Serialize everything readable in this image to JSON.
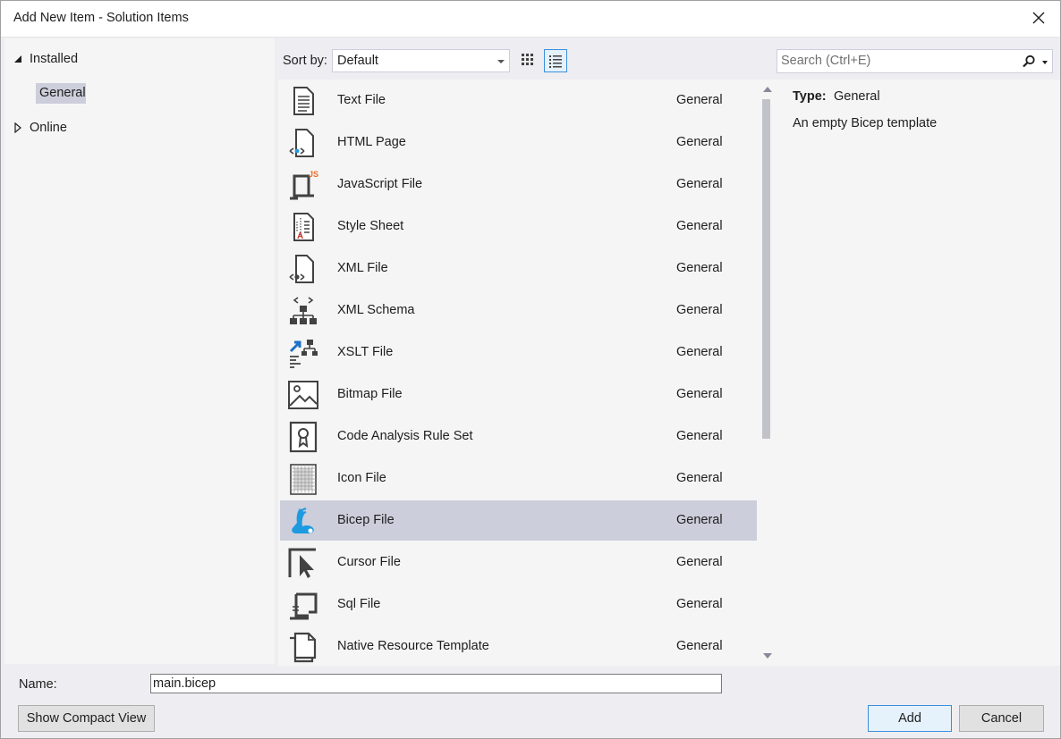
{
  "window": {
    "title": "Add New Item - Solution Items"
  },
  "tree": {
    "installed": "Installed",
    "general": "General",
    "online": "Online"
  },
  "toolbar": {
    "sort_label": "Sort by:",
    "sort_value": "Default"
  },
  "search": {
    "placeholder": "Search (Ctrl+E)"
  },
  "items": [
    {
      "name": "Text File",
      "category": "General",
      "icon": "text-file-icon"
    },
    {
      "name": "HTML Page",
      "category": "General",
      "icon": "html-page-icon"
    },
    {
      "name": "JavaScript File",
      "category": "General",
      "icon": "javascript-file-icon"
    },
    {
      "name": "Style Sheet",
      "category": "General",
      "icon": "style-sheet-icon"
    },
    {
      "name": "XML File",
      "category": "General",
      "icon": "xml-file-icon"
    },
    {
      "name": "XML Schema",
      "category": "General",
      "icon": "xml-schema-icon"
    },
    {
      "name": "XSLT File",
      "category": "General",
      "icon": "xslt-file-icon"
    },
    {
      "name": "Bitmap File",
      "category": "General",
      "icon": "bitmap-file-icon"
    },
    {
      "name": "Code Analysis Rule Set",
      "category": "General",
      "icon": "rule-set-icon"
    },
    {
      "name": "Icon File",
      "category": "General",
      "icon": "icon-file-icon"
    },
    {
      "name": "Bicep File",
      "category": "General",
      "icon": "bicep-file-icon",
      "selected": true
    },
    {
      "name": "Cursor File",
      "category": "General",
      "icon": "cursor-file-icon"
    },
    {
      "name": "Sql File",
      "category": "General",
      "icon": "sql-file-icon"
    },
    {
      "name": "Native Resource Template",
      "category": "General",
      "icon": "native-resource-icon"
    }
  ],
  "details": {
    "type_label": "Type:",
    "type_value": "General",
    "description": "An empty Bicep template"
  },
  "footer": {
    "name_label": "Name:",
    "name_value": "main.bicep",
    "compact_label": "Show Compact View",
    "add_label": "Add",
    "cancel_label": "Cancel"
  },
  "colors": {
    "selection": "#cccedb",
    "dialog_bg": "#eeeef2",
    "pane_bg": "#f5f5f5",
    "accent": "#3c8fdc",
    "bicep_blue": "#1e9ae0",
    "js_orange": "#e8702a",
    "xslt_blue": "#1e70c8"
  }
}
